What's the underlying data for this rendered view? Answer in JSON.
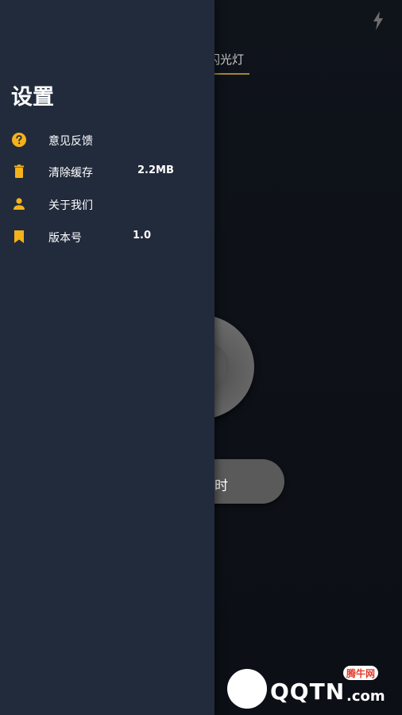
{
  "drawer": {
    "title": "设置",
    "items": [
      {
        "label": "意见反馈",
        "value": "",
        "icon": "help-circle-icon"
      },
      {
        "label": "清除缓存",
        "value": "2.2MB",
        "icon": "trash-icon"
      },
      {
        "label": "关于我们",
        "value": "",
        "icon": "person-icon"
      },
      {
        "label": "版本号",
        "value": "1.0",
        "icon": "bookmark-icon"
      }
    ]
  },
  "background": {
    "tab_label": "闪光灯",
    "timer_label": "定时"
  },
  "watermark": {
    "text": "QQTN",
    "dotcom": ".com",
    "badge": "腾牛网"
  },
  "colors": {
    "drawer_bg": "#222b3c",
    "app_bg": "#0d1017",
    "icon_accent": "#f5b21a",
    "tab_underline": "#c9a23a"
  }
}
